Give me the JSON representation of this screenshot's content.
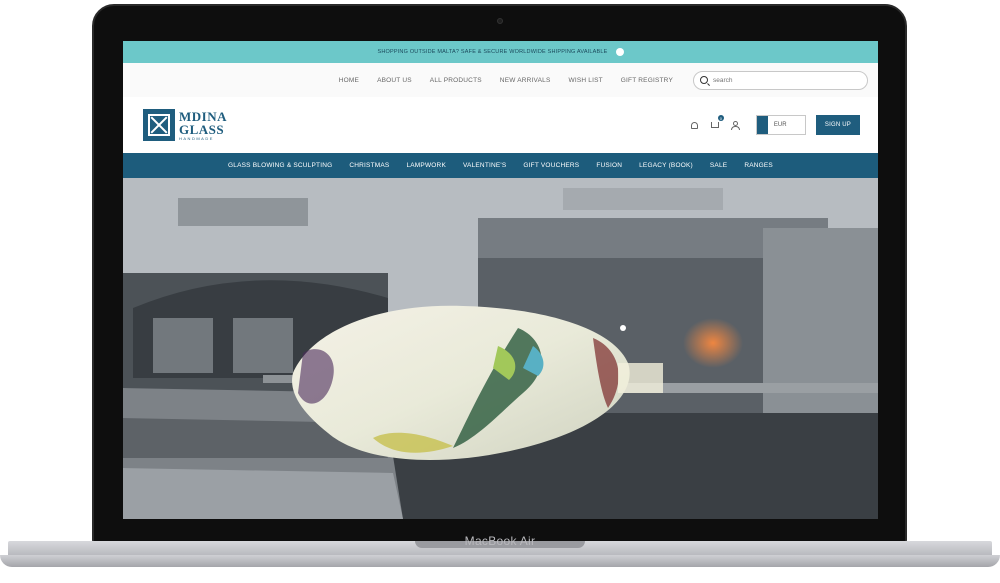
{
  "device": {
    "label": "MacBook Air"
  },
  "announcement": {
    "text": "SHOPPING OUTSIDE MALTA? SAFE & SECURE WORLDWIDE SHIPPING AVAILABLE"
  },
  "topnav": {
    "links": [
      "HOME",
      "ABOUT US",
      "ALL PRODUCTS",
      "NEW ARRIVALS",
      "WISH LIST",
      "GIFT REGISTRY"
    ],
    "search_placeholder": "search"
  },
  "logo": {
    "line1": "MDINA",
    "line2": "GLASS",
    "tagline": "HANDMADE"
  },
  "header": {
    "cart_count": "0",
    "currency": "EUR",
    "signup_label": "SIGN UP"
  },
  "categories": [
    "GLASS BLOWING & SCULPTING",
    "CHRISTMAS",
    "LAMPWORK",
    "VALENTINE'S",
    "GIFT VOUCHERS",
    "FUSION",
    "LEGACY (BOOK)",
    "SALE",
    "RANGES"
  ],
  "colors": {
    "brand": "#1d5c7c",
    "announcement_bg": "#6cc8c9"
  },
  "hero": {
    "image_subject": "hot glass on blowpipe"
  }
}
